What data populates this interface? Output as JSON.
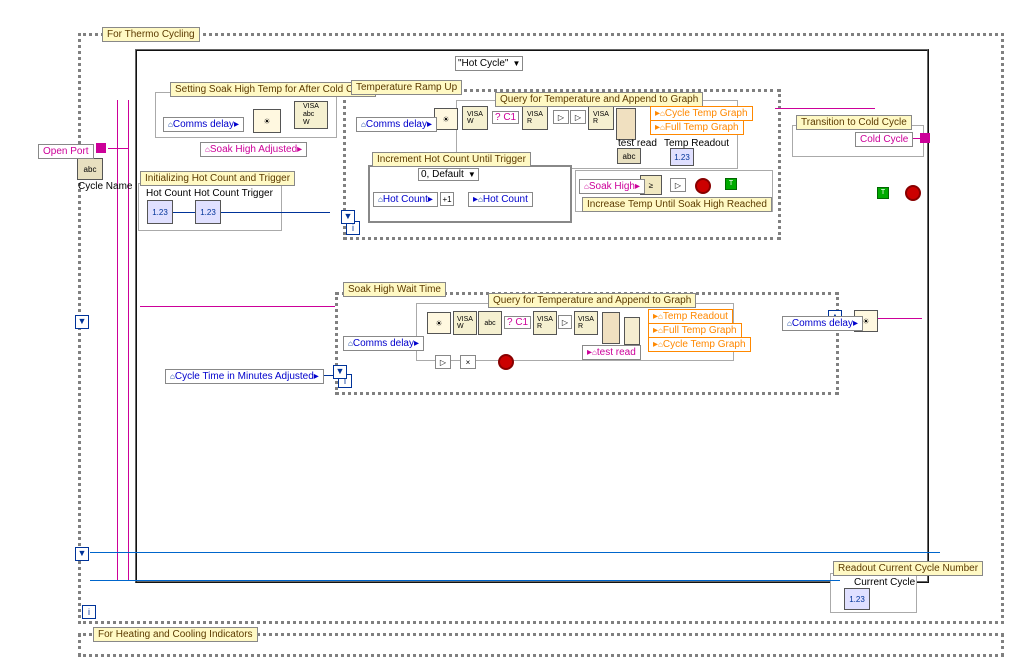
{
  "outer": {
    "title": "For Thermo Cycling"
  },
  "case_selector": {
    "value": "\"Hot Cycle\""
  },
  "open_port": "Open Port",
  "cycle_name": "Cycle Name",
  "soak_high_section": {
    "title": "Setting Soak High Temp for After Cold Cycle",
    "comms": "Comms delay",
    "soak_high": "Soak High Adjusted"
  },
  "init_section": {
    "title": "Initializing Hot Count and Trigger",
    "hot_count": "Hot Count",
    "hot_count_trigger": "Hot Count Trigger"
  },
  "ramp_up": {
    "title": "Temperature Ramp Up",
    "query_title": "Query for Temperature and Append to Graph",
    "comms": "Comms delay",
    "c1": "? C1",
    "test_read": "test read",
    "temp_readout": "Temp Readout",
    "cycle_graph": "Cycle Temp Graph",
    "full_graph": "Full Temp Graph",
    "increment_title": "Increment Hot Count Until Trigger",
    "increment_case": "0, Default",
    "hot_count_in": "Hot Count",
    "hot_count_out": "Hot Count",
    "soak_high": "Soak High",
    "increase_title": "Increase Temp Until Soak High Reached"
  },
  "transition": {
    "title": "Transition to Cold Cycle",
    "cold": "Cold Cycle"
  },
  "wait_time": {
    "title": "Soak High Wait Time",
    "query_title": "Query for Temperature and Append to Graph",
    "comms": "Comms delay",
    "c1": "? C1",
    "temp_readout": "Temp Readout",
    "full_graph": "Full Temp Graph",
    "cycle_graph": "Cycle Temp Graph",
    "test_read": "test read",
    "comms2": "Comms delay"
  },
  "cycle_time": "Cycle Time in Minutes Adjusted",
  "readout": {
    "title": "Readout Current Cycle Number",
    "current": "Current Cycle"
  },
  "heating": {
    "title": "For Heating and Cooling Indicators"
  },
  "icons": {
    "num": "1.23",
    "visa": "VISA\nabc",
    "w": "W",
    "r": "R",
    "i": "i"
  }
}
